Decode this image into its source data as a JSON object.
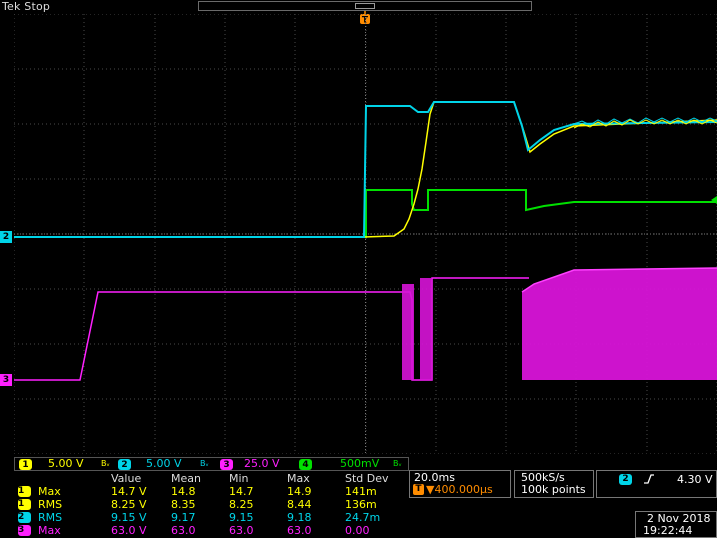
{
  "header": {
    "status": "Tek Stop"
  },
  "colors": {
    "ch1": "#ffff00",
    "ch2": "#00d4e8",
    "ch3": "#ff20ff",
    "ch4": "#00e000"
  },
  "markers": {
    "trigger": "T",
    "ch2": "2",
    "ch3": "3"
  },
  "channels": [
    {
      "num": "1",
      "scale": "5.00 V",
      "bw": "Bᵥ"
    },
    {
      "num": "2",
      "scale": "5.00 V",
      "bw": "Bᵥ"
    },
    {
      "num": "3",
      "scale": "25.0 V",
      "bw": "Bᵥ"
    },
    {
      "num": "4",
      "scale": "500mV",
      "bw": "Bᵥ"
    }
  ],
  "measurements": {
    "headers": [
      "Value",
      "Mean",
      "Min",
      "Max",
      "Std Dev"
    ],
    "rows": [
      {
        "ch": "1",
        "type": "Max",
        "value": "14.7 V",
        "mean": "14.8",
        "min": "14.7",
        "max": "14.9",
        "std": "141m"
      },
      {
        "ch": "1",
        "type": "RMS",
        "value": "8.25 V",
        "mean": "8.35",
        "min": "8.25",
        "max": "8.44",
        "std": "136m"
      },
      {
        "ch": "2",
        "type": "RMS",
        "value": "9.15 V",
        "mean": "9.17",
        "min": "9.15",
        "max": "9.18",
        "std": "24.7m"
      },
      {
        "ch": "3",
        "type": "Max",
        "value": "63.0 V",
        "mean": "63.0",
        "min": "63.0",
        "max": "63.0",
        "std": "0.00"
      }
    ]
  },
  "horizontal": {
    "scale": "20.0ms",
    "trigger_pos": "▼400.000µs"
  },
  "acquisition": {
    "rate": "500kS/s",
    "points": "100k points"
  },
  "trigger": {
    "source": "2",
    "slope_icon": "rising-edge",
    "level": "4.30 V"
  },
  "datetime": {
    "date": "2 Nov 2018",
    "time": "19:22:44"
  }
}
